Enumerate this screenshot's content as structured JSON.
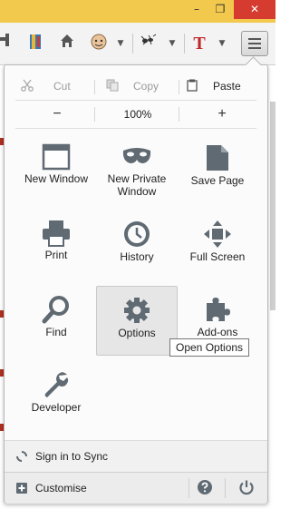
{
  "window_controls": {
    "minimize": "–",
    "maximize": "❐",
    "close": "✕"
  },
  "toolbar": {
    "icons": [
      "download-icon",
      "bookmarks-icon",
      "home-icon",
      "addon-face-icon",
      "addon-dropdown-icon",
      "addon-ant-icon",
      "addon-dropdown-icon",
      "addon-T-icon",
      "addon-dropdown-icon",
      "menu-icon"
    ],
    "addon_letter": "T"
  },
  "menu": {
    "edit": {
      "cut": "Cut",
      "copy": "Copy",
      "paste": "Paste"
    },
    "zoom": {
      "minus": "−",
      "value": "100%",
      "plus": "+"
    },
    "items": [
      {
        "label": "New Window",
        "icon": "new-window-icon"
      },
      {
        "label": "New Private\nWindow",
        "icon": "private-mask-icon"
      },
      {
        "label": "Save Page",
        "icon": "save-page-icon"
      },
      {
        "label": "Print",
        "icon": "printer-icon"
      },
      {
        "label": "History",
        "icon": "history-clock-icon"
      },
      {
        "label": "Full Screen",
        "icon": "fullscreen-icon"
      },
      {
        "label": "Find",
        "icon": "magnifier-icon"
      },
      {
        "label": "Options",
        "icon": "gear-icon",
        "selected": true
      },
      {
        "label": "Add-ons",
        "icon": "puzzle-icon"
      },
      {
        "label": "Developer",
        "icon": "wrench-icon"
      }
    ],
    "tooltip": "Open Options",
    "sync_label": "Sign in to Sync",
    "customise_label": "Customise"
  },
  "colors": {
    "titlebar": "#f2c94c",
    "close_button": "#d53b2f",
    "icon_gray": "#5f6a73",
    "accent_red": "#c0262b"
  }
}
